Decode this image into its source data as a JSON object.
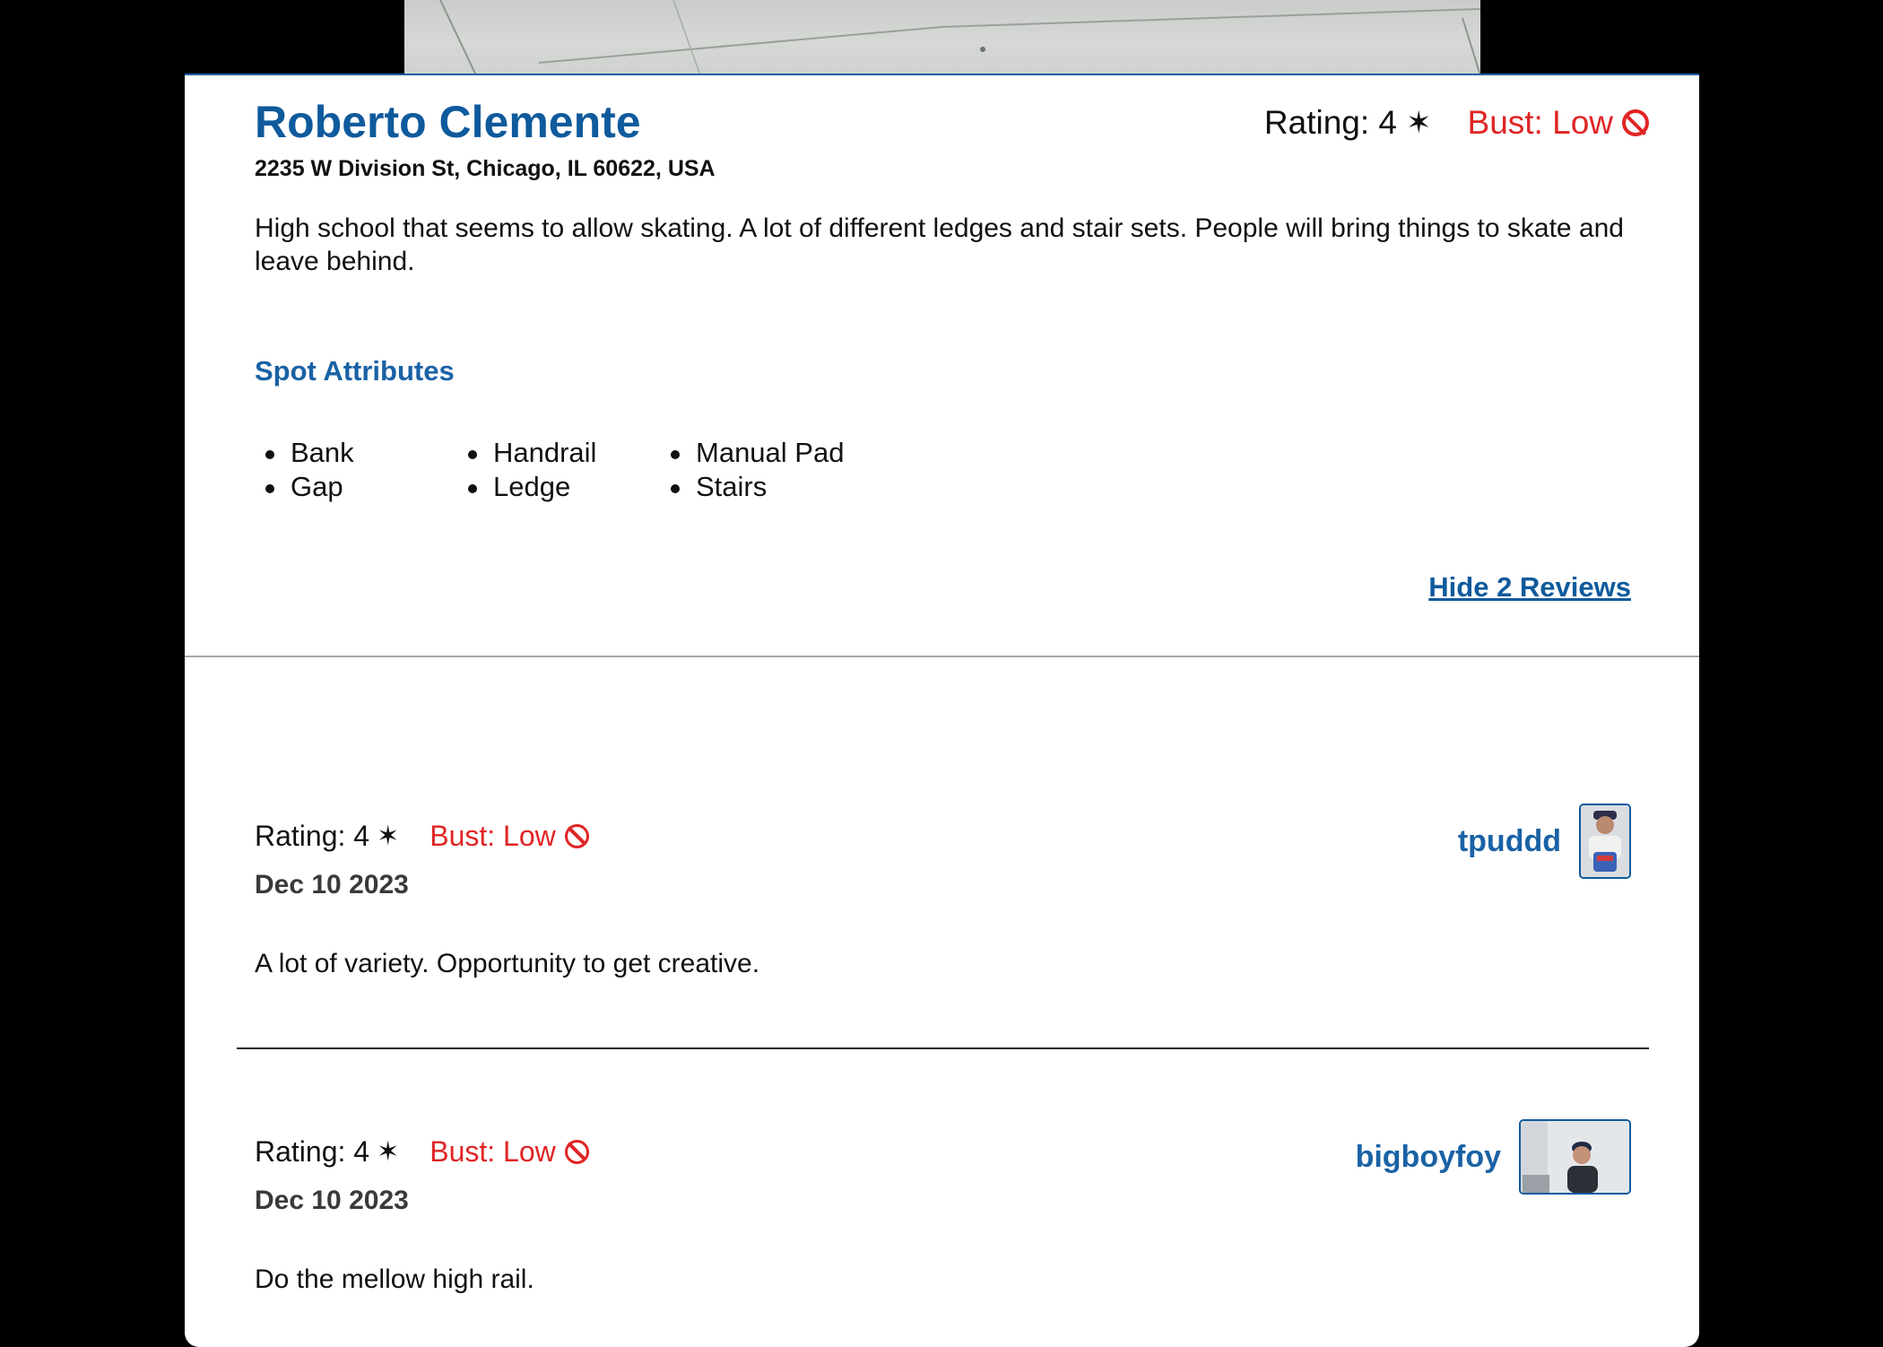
{
  "spot": {
    "name": "Roberto Clemente",
    "address": "2235 W Division St, Chicago, IL 60622, USA",
    "rating_label": "Rating: 4",
    "bust_label": "Bust: Low",
    "description": "High school that seems to allow skating. A lot of different ledges and stair sets. People will bring things to skate and leave behind."
  },
  "attributes": {
    "title": "Spot Attributes",
    "items": [
      "Bank",
      "Gap",
      "Handrail",
      "Ledge",
      "Manual Pad",
      "Stairs"
    ]
  },
  "reviews_toggle": "Hide 2 Reviews",
  "reviews": [
    {
      "rating_label": "Rating: 4",
      "bust_label": "Bust: Low",
      "date": "Dec 10 2023",
      "text": "A lot of variety. Opportunity to get creative.",
      "username": "tpuddd"
    },
    {
      "rating_label": "Rating: 4",
      "bust_label": "Bust: Low",
      "date": "Dec 10 2023",
      "text": "Do the mellow high rail.",
      "username": "bigboyfoy"
    }
  ],
  "icons": {
    "rating": "star-icon",
    "bust": "prohibited-icon",
    "avatar": "user-avatar"
  },
  "colors": {
    "accent": "#0f5a9c",
    "bust": "#e02424",
    "background": "#000000"
  }
}
